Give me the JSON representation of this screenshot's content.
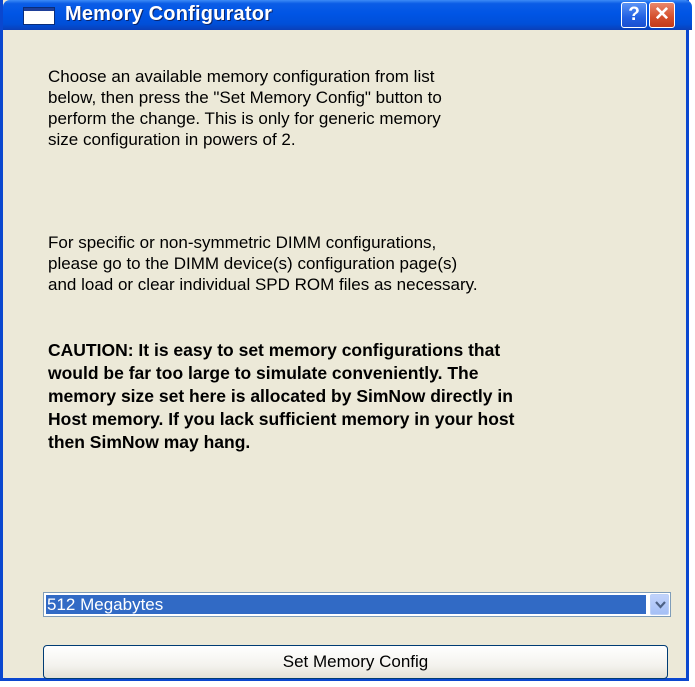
{
  "window": {
    "title": "Memory Configurator",
    "help_label": "?",
    "close_label": "✕",
    "icon": "window-app-icon"
  },
  "content": {
    "intro_text": "Choose an available memory configuration from list\nbelow, then press the \"Set Memory Config\" button to\nperform the change. This is only for generic memory\nsize configuration in powers of 2.",
    "dimm_text": "For specific or non-symmetric DIMM configurations,\nplease go to the DIMM device(s) configuration page(s)\nand load or clear individual SPD ROM files as necessary.",
    "caution_text": "CAUTION: It is easy to set memory configurations that\nwould be far too large to simulate conveniently. The\nmemory size set here is allocated by SimNow directly in\nHost memory. If you lack sufficient memory in your host\nthen SimNow may hang."
  },
  "memory_select": {
    "selected_value": "512 Megabytes",
    "icon": "chevron-down-icon"
  },
  "set_button": {
    "label": "Set Memory Config"
  },
  "colors": {
    "titlebar": "#0055e5",
    "window_bg": "#ece9d8",
    "selection": "#316ac5",
    "close": "#d44e2b"
  }
}
